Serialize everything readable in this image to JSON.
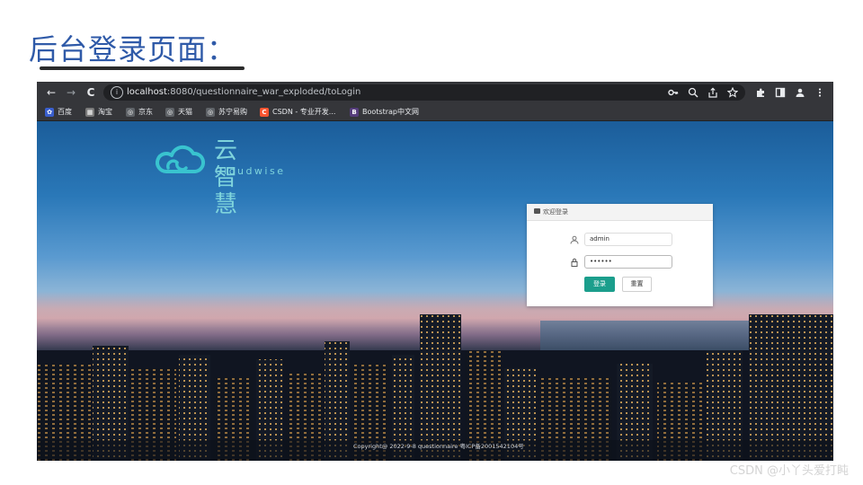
{
  "slide": {
    "title": "后台登录页面："
  },
  "browser": {
    "nav": {
      "back_icon": "←",
      "forward_icon": "→",
      "reload_icon": "C"
    },
    "url_host": "localhost",
    "url_rest": ":8080/questionnaire_war_exploded/toLogin",
    "omnibox_icons": [
      "key-icon",
      "zoom-icon",
      "share-icon",
      "star-icon"
    ],
    "toolbar_icons": [
      "extensions-icon",
      "sidebar-icon",
      "profile-icon",
      "menu-icon"
    ],
    "bookmarks": [
      {
        "label": "百度",
        "icon_color": "#3a5fcd",
        "icon_text": "✿"
      },
      {
        "label": "淘宝",
        "icon_color": "#7a7a7a",
        "icon_text": "▦"
      },
      {
        "label": "京东",
        "icon_color": "#5f6368",
        "icon_text": "◎"
      },
      {
        "label": "天猫",
        "icon_color": "#5f6368",
        "icon_text": "◎"
      },
      {
        "label": "苏宁易购",
        "icon_color": "#5f6368",
        "icon_text": "◎"
      },
      {
        "label": "CSDN - 专业开发...",
        "icon_color": "#fc5531",
        "icon_text": "C"
      },
      {
        "label": "Bootstrap中文网",
        "icon_color": "#563d7c",
        "icon_text": "B"
      }
    ]
  },
  "page": {
    "logo_cn": "云智慧",
    "logo_en": "Cloudwise",
    "accent_color": "#1b9e8c",
    "login": {
      "header": "欢迎登录",
      "username_value": "admin",
      "password_value": "••••••",
      "login_button": "登录",
      "reset_button": "重置"
    },
    "copyright": "Copyright@ 2022-9-8 questionnaire 粤ICP备2001542104号"
  },
  "watermark": "CSDN @小丫头爱打盹"
}
